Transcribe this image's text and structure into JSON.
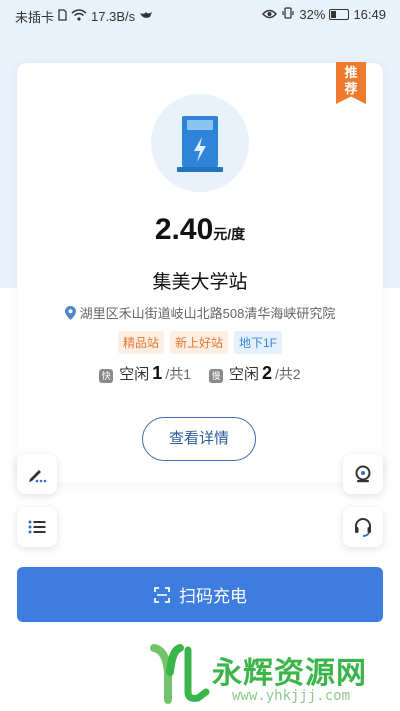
{
  "status_bar": {
    "carrier": "未插卡",
    "net_speed": "17.3B/s",
    "battery_percent": "32%",
    "time": "16:49"
  },
  "station": {
    "recommend_label": "推荐",
    "price_value": "2.40",
    "price_unit": "元/度",
    "name": "集美大学站",
    "address": "湖里区禾山街道岐山北路508清华海峡研究院",
    "tags": [
      "精品站",
      "新上好站",
      "地下1F"
    ],
    "fast": {
      "badge": "快",
      "label": "空闲",
      "free": "1",
      "total": "/共1"
    },
    "slow": {
      "badge": "慢",
      "label": "空闲",
      "free": "2",
      "total": "/共2"
    },
    "detail_button": "查看详情"
  },
  "scan_button": {
    "label": "扫码充电",
    "icon": "scan-icon"
  },
  "side_tools": {
    "left": [
      "edit-icon",
      "list-icon"
    ],
    "right": [
      "location-icon",
      "headset-icon"
    ]
  },
  "watermark": {
    "title": "永辉资源网",
    "url": "www.yhkjjj.com"
  },
  "colors": {
    "primary": "#3e7de0",
    "accent_orange": "#ee7b2c",
    "tag_blue": "#3a87d6",
    "top_background": "#e9f1fb",
    "watermark_green": "#3bb54a"
  }
}
